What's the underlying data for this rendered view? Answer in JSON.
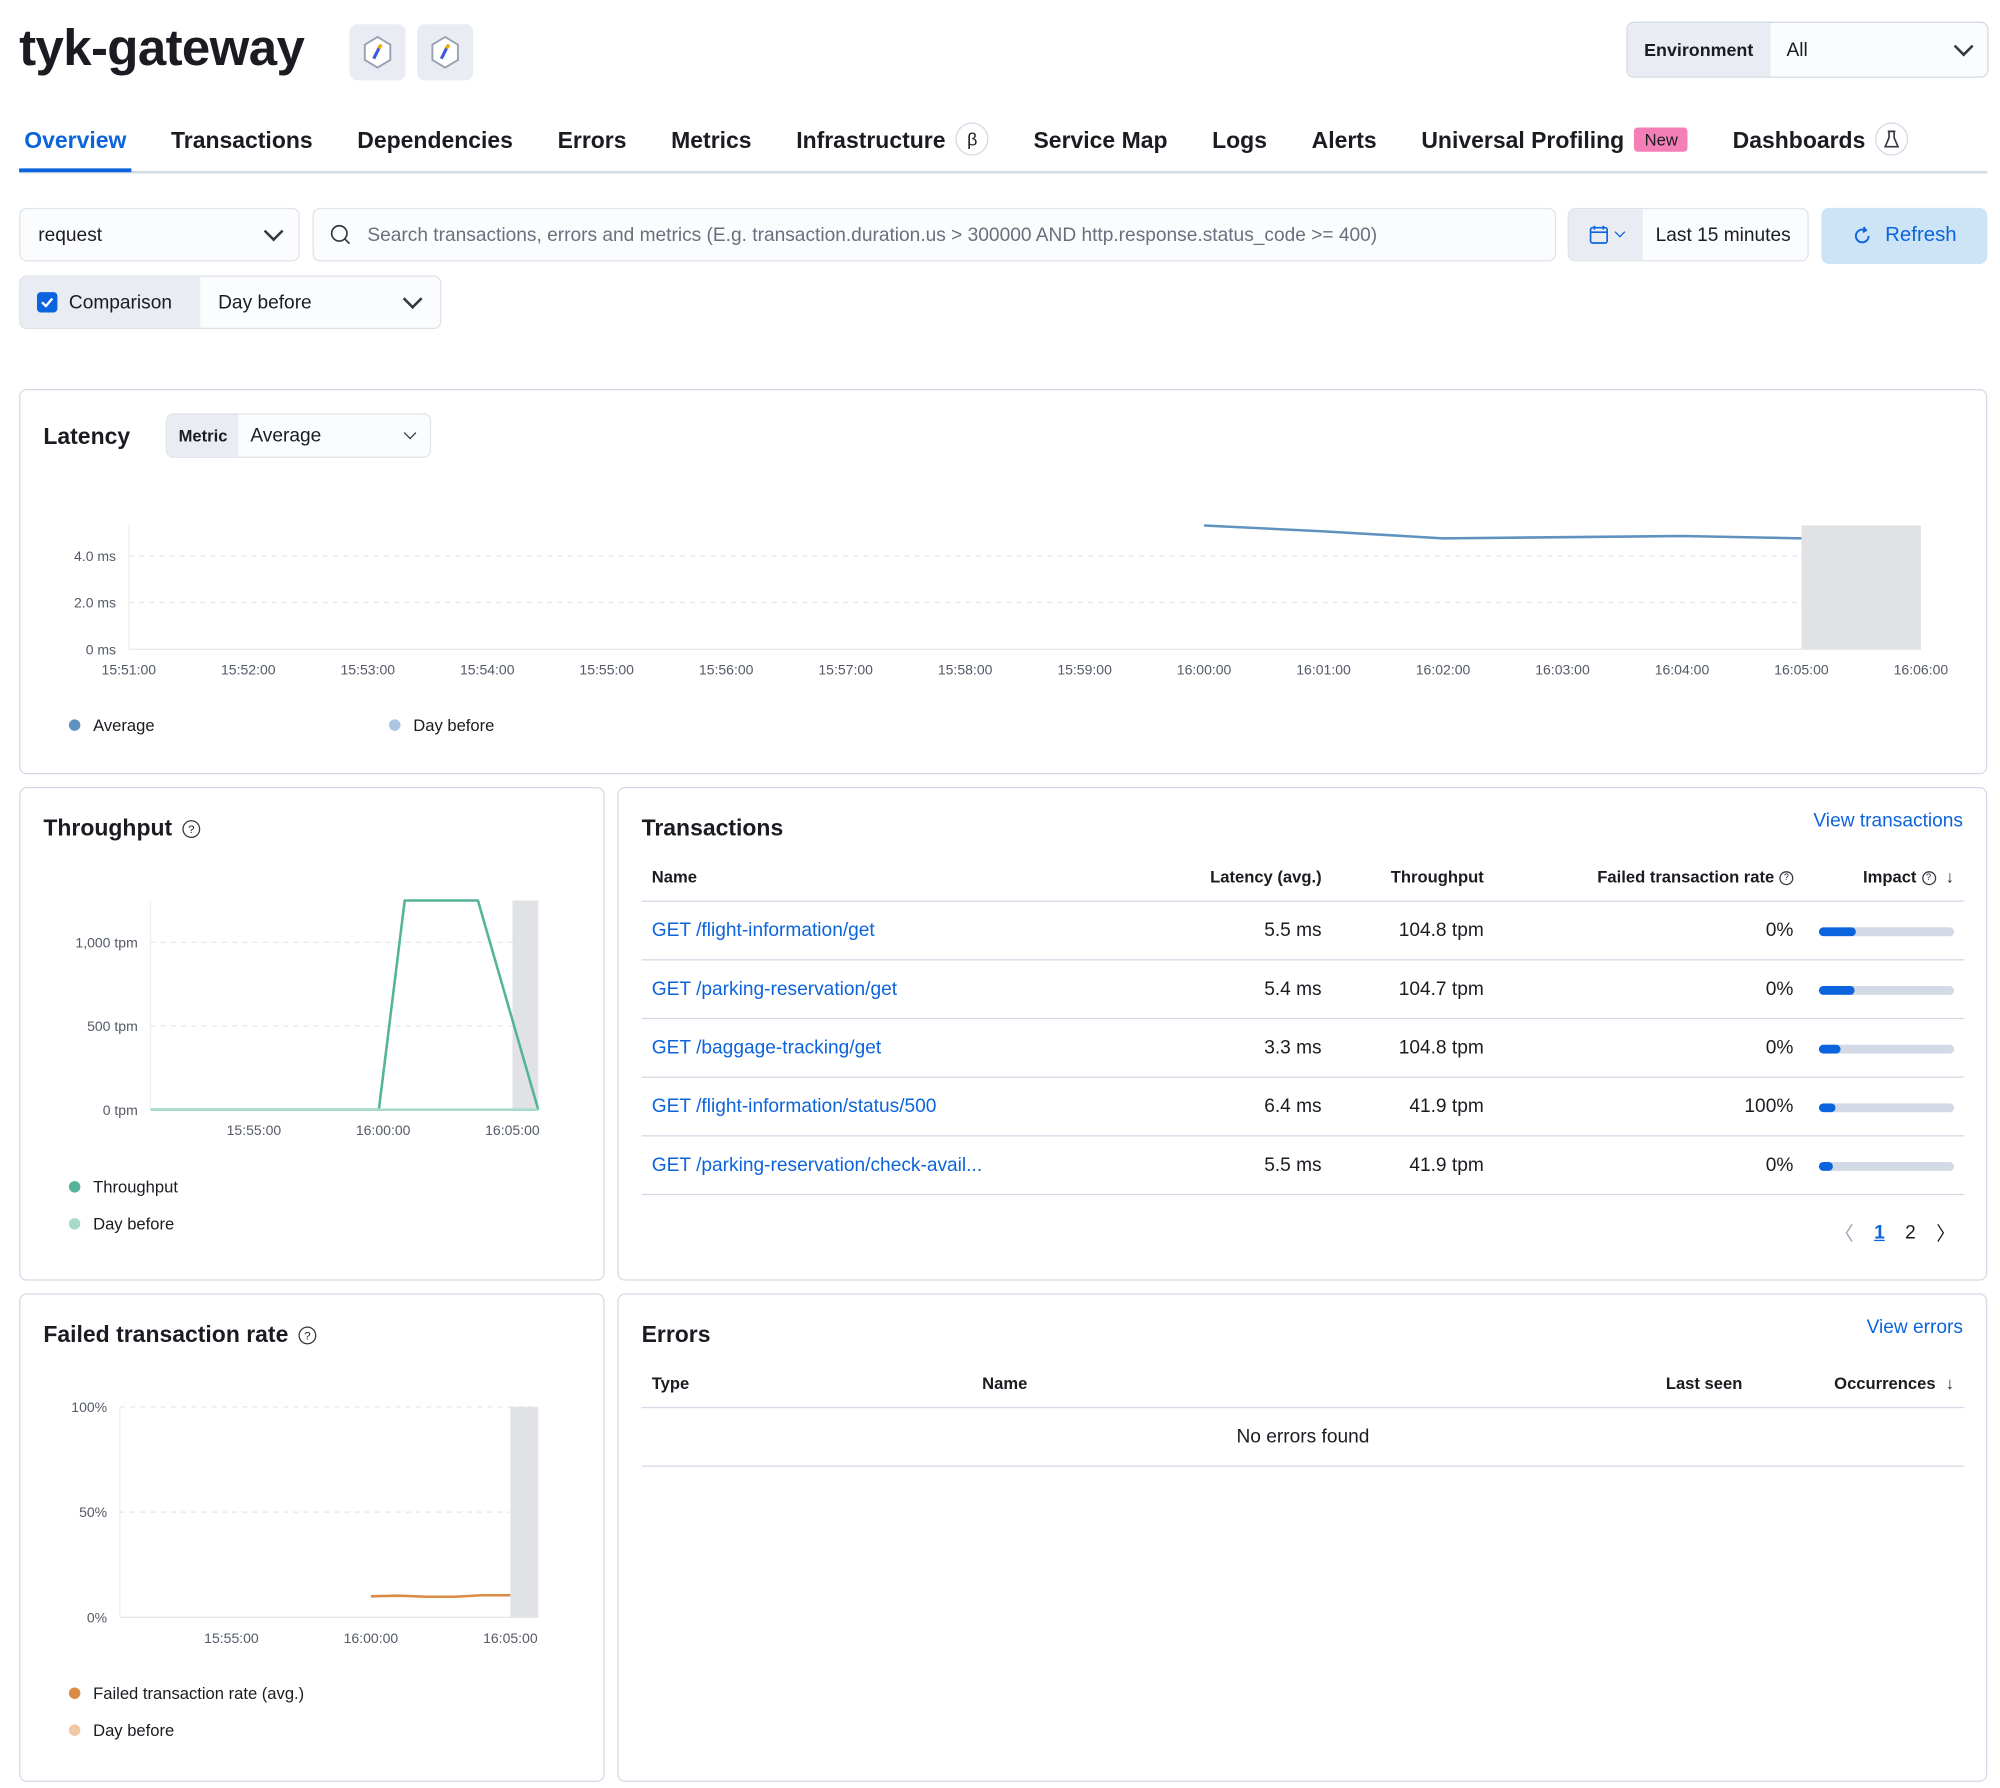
{
  "header": {
    "title": "tyk-gateway",
    "service_icons": [
      "service-icon",
      "agent-icon"
    ],
    "environment": {
      "label": "Environment",
      "value": "All"
    }
  },
  "tabs": [
    {
      "label": "Overview",
      "active": true
    },
    {
      "label": "Transactions"
    },
    {
      "label": "Dependencies"
    },
    {
      "label": "Errors"
    },
    {
      "label": "Metrics"
    },
    {
      "label": "Infrastructure",
      "suffix": "β"
    },
    {
      "label": "Service Map"
    },
    {
      "label": "Logs"
    },
    {
      "label": "Alerts"
    },
    {
      "label": "Universal Profiling",
      "badge": "New"
    },
    {
      "label": "Dashboards",
      "suffix": "flask-icon"
    }
  ],
  "filters": {
    "transaction_type": "request",
    "search_placeholder": "Search transactions, errors and metrics (E.g. transaction.duration.us > 300000 AND http.response.status_code >= 400)",
    "time_range": "Last 15 minutes",
    "refresh": "Refresh",
    "comparison_label": "Comparison",
    "comparison_checked": true,
    "comparison_value": "Day before"
  },
  "colors": {
    "accent": "#0b64dd",
    "latency": "#6092c0",
    "throughput": "#54b399",
    "failed": "#da8b45"
  },
  "latency": {
    "title": "Latency",
    "metric_label": "Metric",
    "metric_value": "Average",
    "legend": [
      "Average",
      "Day before"
    ]
  },
  "throughput": {
    "title": "Throughput",
    "legend": [
      "Throughput",
      "Day before"
    ]
  },
  "failed": {
    "title": "Failed transaction rate",
    "legend": [
      "Failed transaction rate (avg.)",
      "Day before"
    ]
  },
  "chart_data": [
    {
      "type": "line",
      "name": "latency",
      "xticks": [
        "15:51:00",
        "15:52:00",
        "15:53:00",
        "15:54:00",
        "15:55:00",
        "15:56:00",
        "15:57:00",
        "15:58:00",
        "15:59:00",
        "16:00:00",
        "16:01:00",
        "16:02:00",
        "16:03:00",
        "16:04:00",
        "16:05:00",
        "16:06:00"
      ],
      "yticks": [
        "0 ms",
        "2.0 ms",
        "4.0 ms"
      ],
      "ylim": [
        0,
        5.3
      ],
      "xlim": [
        "15:51:00",
        "16:06:00"
      ],
      "series": [
        {
          "name": "Average",
          "x": [
            "16:00:00",
            "16:01:00",
            "16:02:00",
            "16:03:00",
            "16:04:00",
            "16:05:00"
          ],
          "y": [
            5.3,
            5.05,
            4.75,
            4.8,
            4.85,
            4.75
          ]
        }
      ],
      "shaded_from": "16:05:00",
      "grid": true,
      "legend": "bottom"
    },
    {
      "type": "line",
      "name": "throughput",
      "xticks": [
        "15:55:00",
        "16:00:00",
        "16:05:00"
      ],
      "yticks": [
        "0 tpm",
        "500 tpm",
        "1,000 tpm"
      ],
      "ylim": [
        0,
        1250
      ],
      "xlim": [
        "15:51:00",
        "16:06:00"
      ],
      "series": [
        {
          "name": "Throughput",
          "x": [
            "15:51:00",
            "15:59:50",
            "16:00:50",
            "16:03:40",
            "16:06:00"
          ],
          "y": [
            0,
            0,
            1250,
            1250,
            0
          ]
        },
        {
          "name": "Day before",
          "x": [
            "15:51:00",
            "16:06:00"
          ],
          "y": [
            0,
            0
          ]
        }
      ],
      "shaded_from": "16:05:00",
      "grid": true,
      "legend": "bottom"
    },
    {
      "type": "line",
      "name": "failed",
      "xticks": [
        "15:55:00",
        "16:00:00",
        "16:05:00"
      ],
      "yticks": [
        "0%",
        "50%",
        "100%"
      ],
      "ylim": [
        0,
        100
      ],
      "xlim": [
        "15:51:00",
        "16:06:00"
      ],
      "series": [
        {
          "name": "Failed transaction rate (avg.)",
          "x": [
            "16:00:00",
            "16:01:00",
            "16:02:00",
            "16:03:00",
            "16:04:00",
            "16:05:00"
          ],
          "y": [
            10,
            10.3,
            9.8,
            9.8,
            10.5,
            10.5
          ]
        }
      ],
      "shaded_from": "16:05:00",
      "grid": true,
      "legend": "bottom"
    }
  ],
  "transactions": {
    "title": "Transactions",
    "view_link": "View transactions",
    "columns": [
      "Name",
      "Latency (avg.)",
      "Throughput",
      "Failed transaction rate",
      "Impact"
    ],
    "rows": [
      {
        "name": "GET /flight-information/get",
        "latency": "5.5 ms",
        "throughput": "104.8 tpm",
        "failed": "0%",
        "impact": 27
      },
      {
        "name": "GET /parking-reservation/get",
        "latency": "5.4 ms",
        "throughput": "104.7 tpm",
        "failed": "0%",
        "impact": 26
      },
      {
        "name": "GET /baggage-tracking/get",
        "latency": "3.3 ms",
        "throughput": "104.8 tpm",
        "failed": "0%",
        "impact": 16
      },
      {
        "name": "GET /flight-information/status/500",
        "latency": "6.4 ms",
        "throughput": "41.9 tpm",
        "failed": "100%",
        "impact": 12
      },
      {
        "name": "GET /parking-reservation/check-avail...",
        "latency": "5.5 ms",
        "throughput": "41.9 tpm",
        "failed": "0%",
        "impact": 10
      }
    ],
    "pagination": {
      "pages": [
        "1",
        "2"
      ],
      "current": "1"
    }
  },
  "errors": {
    "title": "Errors",
    "view_link": "View errors",
    "columns": [
      "Type",
      "Name",
      "Last seen",
      "Occurrences"
    ],
    "empty": "No errors found"
  }
}
